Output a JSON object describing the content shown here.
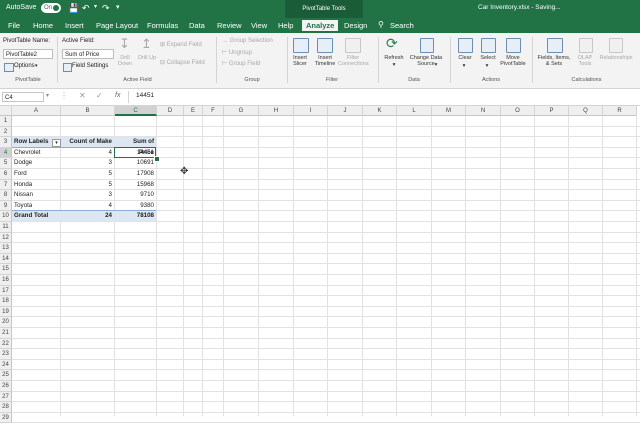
{
  "titlebar": {
    "autosave_label": "AutoSave",
    "autosave_state": "On",
    "context_title": "PivotTable Tools",
    "document_title": "Car Inventory.xlsx - Saving..."
  },
  "tabs": [
    "File",
    "Home",
    "Insert",
    "Page Layout",
    "Formulas",
    "Data",
    "Review",
    "View",
    "Help",
    "Analyze",
    "Design"
  ],
  "search_label": "Search",
  "ribbon": {
    "pt_name_label": "PivotTable Name:",
    "pt_name_value": "PivotTable2",
    "options_label": "Options",
    "group_pivottable": "PivotTable",
    "active_field_label": "Active Field:",
    "active_field_value": "Sum of Price",
    "field_settings_label": "Field Settings",
    "drill_down": "Drill Down",
    "drill_up": "Drill Up",
    "expand_field": "Expand Field",
    "collapse_field": "Collapse Field",
    "group_active_field": "Active Field",
    "group_selection": "Group Selection",
    "ungroup": "Ungroup",
    "group_field": "Group Field",
    "group_group": "Group",
    "insert_slicer": "Insert Slicer",
    "insert_timeline": "Insert Timeline",
    "filter_connections": "Filter Connections",
    "group_filter": "Filter",
    "refresh": "Refresh",
    "change_data_source": "Change Data Source",
    "group_data": "Data",
    "clear": "Clear",
    "select": "Select",
    "move_pivottable": "Move PivotTable",
    "group_actions": "Actions",
    "fields_items_sets": "Fields, Items, & Sets",
    "olap_tools": "OLAP Tools",
    "relationships": "Relationships",
    "group_calculations": "Calculations"
  },
  "formula_bar": {
    "name_box": "C4",
    "fx": "fx",
    "value": "14451"
  },
  "columns": [
    "A",
    "B",
    "C",
    "D",
    "E",
    "F",
    "G",
    "H",
    "I",
    "J",
    "K",
    "L",
    "M",
    "N",
    "O",
    "P",
    "Q",
    "R"
  ],
  "rows": [
    "1",
    "2",
    "3",
    "4",
    "5",
    "6",
    "7",
    "8",
    "9",
    "10",
    "11",
    "12",
    "13",
    "14",
    "15",
    "16",
    "17",
    "18",
    "19",
    "20",
    "21",
    "22",
    "23",
    "24",
    "25",
    "26",
    "27",
    "28",
    "29"
  ],
  "pivot": {
    "headers": [
      "Row Labels",
      "Count of Make",
      "Sum of Price"
    ],
    "rows": [
      [
        "Chevrolet",
        "4",
        "14451"
      ],
      [
        "Dodge",
        "3",
        "10691"
      ],
      [
        "Ford",
        "5",
        "17908"
      ],
      [
        "Honda",
        "5",
        "15968"
      ],
      [
        "Nissan",
        "3",
        "9710"
      ],
      [
        "Toyota",
        "4",
        "9380"
      ]
    ],
    "total": [
      "Grand Total",
      "24",
      "78108"
    ]
  }
}
